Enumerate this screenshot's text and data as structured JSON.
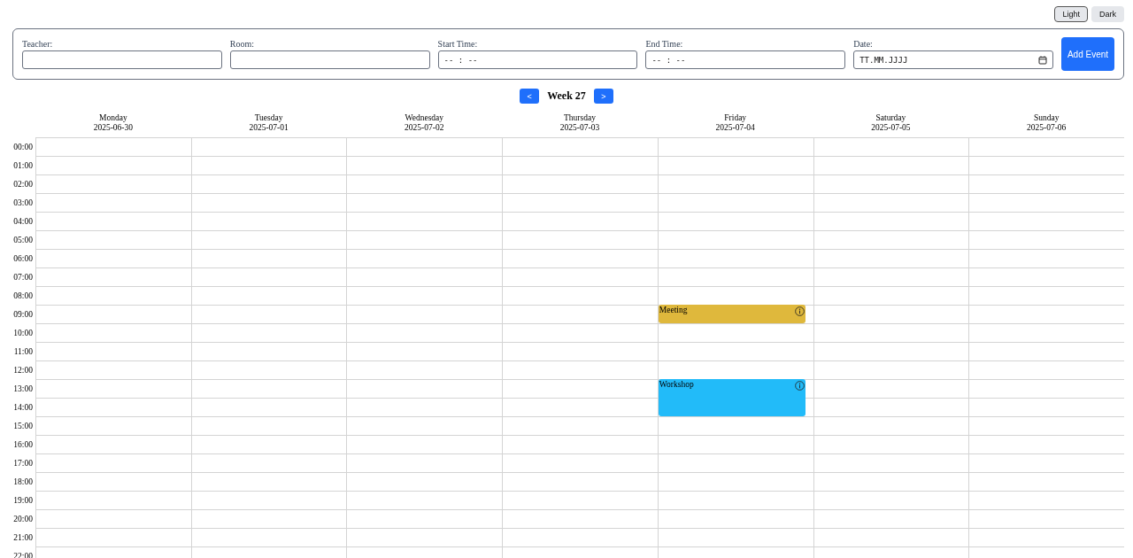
{
  "theme_toggle": [
    {
      "label": "Light",
      "selected": true
    },
    {
      "label": "Dark",
      "selected": false
    }
  ],
  "form": {
    "fields": [
      {
        "label": "Teacher:",
        "kind": "text"
      },
      {
        "label": "Room:",
        "kind": "text"
      },
      {
        "label": "Start Time:",
        "kind": "time",
        "placeholder": "-- : --"
      },
      {
        "label": "End Time:",
        "kind": "time",
        "placeholder": "-- : --"
      },
      {
        "label": "Date:",
        "kind": "date",
        "placeholder": "TT.MM.JJJJ"
      }
    ],
    "submit": "Add Event"
  },
  "week_nav": {
    "prev": "<",
    "title": "Week 27",
    "next": ">"
  },
  "days": [
    {
      "name": "Monday",
      "date": "2025-06-30"
    },
    {
      "name": "Tuesday",
      "date": "2025-07-01"
    },
    {
      "name": "Wednesday",
      "date": "2025-07-02"
    },
    {
      "name": "Thursday",
      "date": "2025-07-03"
    },
    {
      "name": "Friday",
      "date": "2025-07-04",
      "slots": [
        {
          "kind": "free"
        },
        {
          "kind": "free"
        },
        {
          "kind": "free"
        },
        {
          "kind": "free"
        },
        {
          "kind": "free"
        },
        {
          "kind": "free"
        },
        {
          "kind": "free"
        },
        {
          "kind": "free"
        },
        {
          "kind": "free"
        },
        {
          "kind": "event",
          "title": "Meeting",
          "color": "#dfb83c"
        },
        {
          "kind": "free"
        },
        {
          "kind": "free"
        },
        {
          "kind": "free"
        },
        {
          "kind": "event",
          "title": "Workshop",
          "color": "#22bbf9"
        },
        {
          "kind": "continuation"
        }
      ]
    },
    {
      "name": "Saturday",
      "date": "2025-07-05"
    },
    {
      "name": "Sunday",
      "date": "2025-07-06"
    }
  ],
  "hours": [
    "00:00",
    "01:00",
    "02:00",
    "03:00",
    "04:00",
    "05:00",
    "06:00",
    "07:00",
    "08:00",
    "09:00",
    "10:00",
    "11:00",
    "12:00",
    "13:00",
    "14:00",
    "15:00",
    "16:00",
    "17:00",
    "18:00",
    "19:00",
    "20:00",
    "21:00",
    "22:00"
  ]
}
